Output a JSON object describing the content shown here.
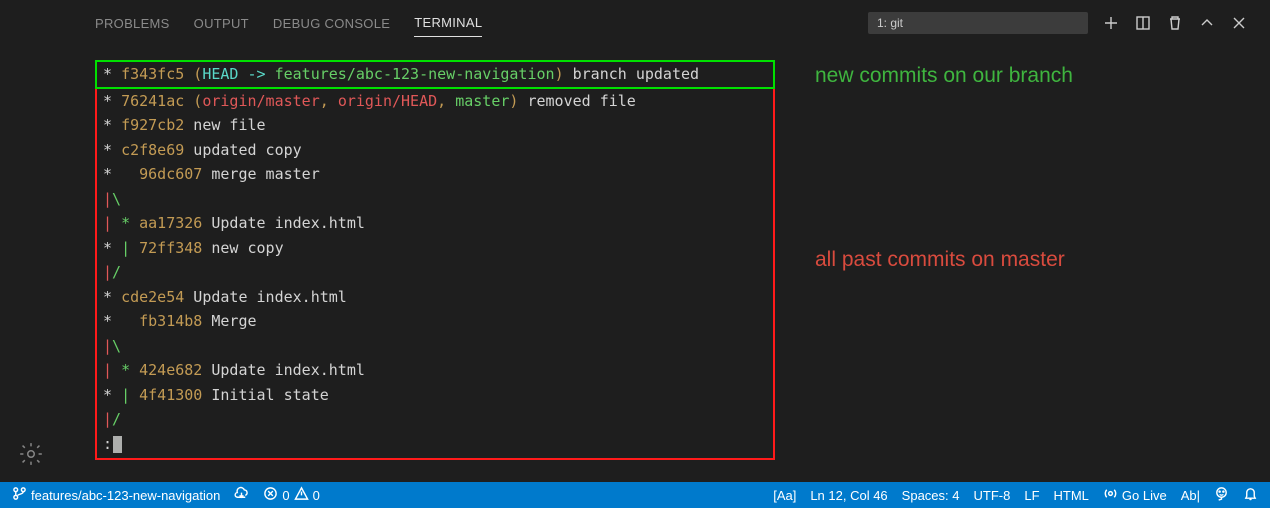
{
  "tabs": {
    "problems": "PROBLEMS",
    "output": "OUTPUT",
    "debug": "DEBUG CONSOLE",
    "terminal": "TERMINAL"
  },
  "dropdown": {
    "label": "1: git"
  },
  "annotations": {
    "green": "new commits on our branch",
    "red": "all past commits on master"
  },
  "log": {
    "head_line": {
      "graph": "* ",
      "hash": "f343fc5",
      "paren_open": " (",
      "head": "HEAD -> ",
      "branch": "features/abc-123-new-navigation",
      "paren_close": ") ",
      "msg": "branch updated"
    },
    "rest": [
      {
        "graph": "* ",
        "hash": "76241ac",
        "refs_open": " (",
        "origin_master": "origin/master",
        "sep1": ", ",
        "origin_head": "origin/HEAD",
        "sep2": ", ",
        "master": "master",
        "refs_close": ") ",
        "msg": "removed file"
      },
      {
        "graph": "* ",
        "hash": "f927cb2",
        "msg": " new file"
      },
      {
        "graph": "* ",
        "hash": "c2f8e69",
        "msg": " updated copy"
      },
      {
        "graph": "*   ",
        "hash": "96dc607",
        "msg": " merge master"
      },
      {
        "graph_raw": "|\\  "
      },
      {
        "graph": "| * ",
        "hash": "aa17326",
        "msg": " Update index.html"
      },
      {
        "graph": "* | ",
        "hash": "72ff348",
        "msg": " new copy"
      },
      {
        "graph_raw": "|/  "
      },
      {
        "graph": "* ",
        "hash": "cde2e54",
        "msg": " Update index.html"
      },
      {
        "graph": "*   ",
        "hash": "fb314b8",
        "msg": " Merge"
      },
      {
        "graph_raw": "|\\  "
      },
      {
        "graph": "| * ",
        "hash": "424e682",
        "msg": " Update index.html"
      },
      {
        "graph": "* | ",
        "hash": "4f41300",
        "msg": " Initial state"
      },
      {
        "graph_raw": "|/  "
      },
      {
        "prompt": ":"
      }
    ]
  },
  "statusbar": {
    "branch": "features/abc-123-new-navigation",
    "errors": "0",
    "warnings": "0",
    "case": "[Aa]",
    "cursor": "Ln 12, Col 46",
    "spaces": "Spaces: 4",
    "encoding": "UTF-8",
    "eol": "LF",
    "lang": "HTML",
    "golive": "Go Live",
    "spell": "Ab|"
  }
}
